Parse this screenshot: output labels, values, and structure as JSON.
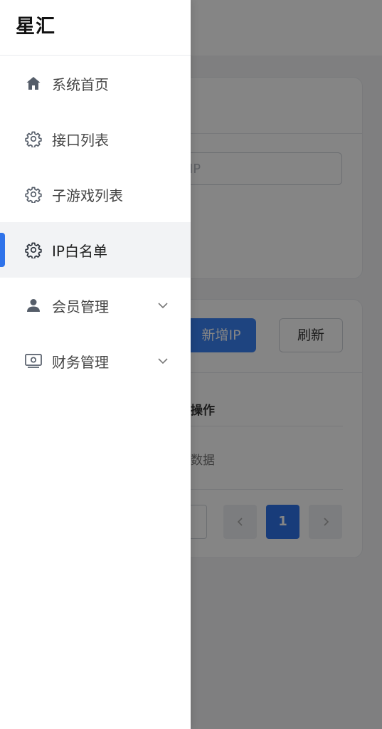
{
  "app": {
    "brand": "星汇"
  },
  "sidebar": {
    "items": [
      {
        "label": "系统首页",
        "icon": "home-icon",
        "active": false,
        "expandable": false
      },
      {
        "label": "接口列表",
        "icon": "gear-icon",
        "active": false,
        "expandable": false
      },
      {
        "label": "子游戏列表",
        "icon": "gear-icon",
        "active": false,
        "expandable": false
      },
      {
        "label": "IP白名单",
        "icon": "gear-icon",
        "active": true,
        "expandable": false
      },
      {
        "label": "会员管理",
        "icon": "user-icon",
        "active": false,
        "expandable": true
      },
      {
        "label": "财务管理",
        "icon": "wallet-icon",
        "active": false,
        "expandable": true
      }
    ]
  },
  "background": {
    "search_placeholder": "IP",
    "add_button": "新增IP",
    "refresh_button": "刷新",
    "table_header_op": "操作",
    "empty_text": "数据",
    "pagination": {
      "current": "1"
    }
  },
  "colors": {
    "accent": "#2f73ea",
    "overlay": "rgba(0,0,0,0.48)"
  }
}
